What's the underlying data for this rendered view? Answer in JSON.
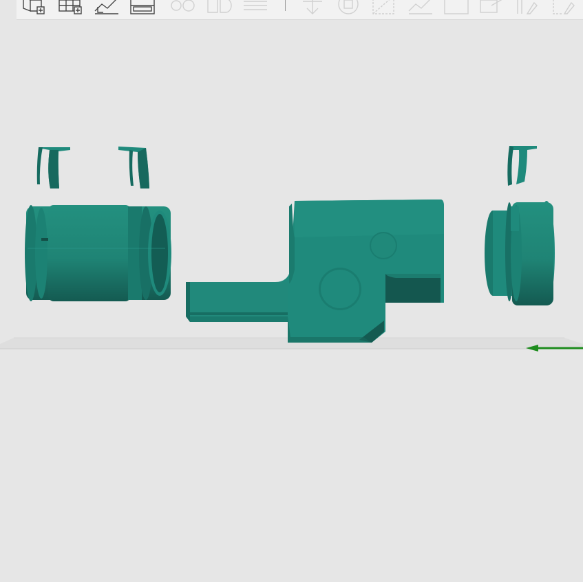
{
  "app": {
    "view": "3D prepare view"
  },
  "colors": {
    "background": "#e6e6e6",
    "toolbar_bg": "#f2f2f2",
    "model": "#1f8a7c",
    "model_dark": "#156a5f",
    "model_light": "#2a9e8e",
    "axis_x": "#1e8c1e",
    "icon_active": "#444444",
    "icon_disabled": "#b5b5b5"
  },
  "toolbar": {
    "tools": [
      {
        "icon": "add-object-icon",
        "enabled": true
      },
      {
        "icon": "add-plate-icon",
        "enabled": true
      },
      {
        "icon": "orient-icon",
        "enabled": true
      },
      {
        "icon": "arrange-icon",
        "enabled": true
      },
      {
        "icon": "split-objects-icon",
        "enabled": false
      },
      {
        "icon": "split-parts-icon",
        "enabled": false
      },
      {
        "icon": "layers-icon",
        "enabled": false
      },
      {
        "icon": "move-icon",
        "enabled": false
      },
      {
        "icon": "rotate-icon",
        "enabled": false
      },
      {
        "icon": "scale-icon",
        "enabled": false
      },
      {
        "icon": "lay-on-face-icon",
        "enabled": false
      },
      {
        "icon": "cut-icon",
        "enabled": false
      },
      {
        "icon": "support-paint-icon",
        "enabled": false
      },
      {
        "icon": "seam-paint-icon",
        "enabled": false
      },
      {
        "icon": "measure-icon",
        "enabled": false
      }
    ]
  },
  "scene": {
    "objects": [
      {
        "name": "clip-left-a"
      },
      {
        "name": "clip-left-b"
      },
      {
        "name": "sleeve-left"
      },
      {
        "name": "main-housing"
      },
      {
        "name": "clip-right"
      },
      {
        "name": "sleeve-right"
      }
    ],
    "axis": {
      "name": "x-axis"
    }
  }
}
